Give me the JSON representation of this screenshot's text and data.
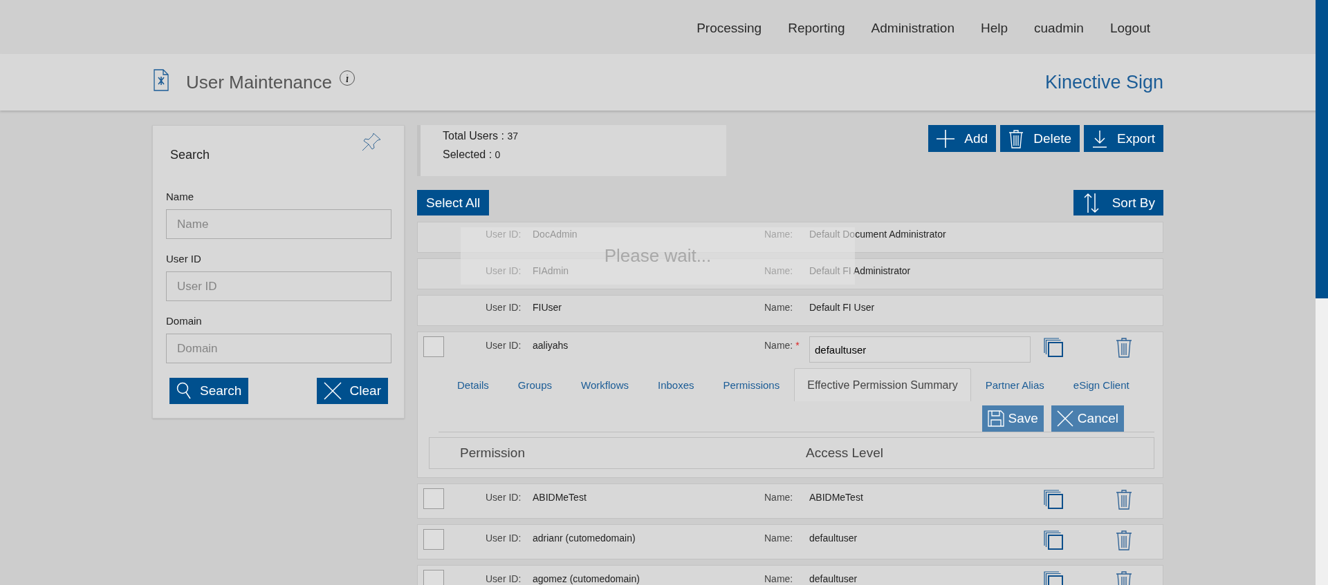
{
  "nav": [
    {
      "label": "Processing"
    },
    {
      "label": "Reporting"
    },
    {
      "label": "Administration"
    },
    {
      "label": "Help"
    },
    {
      "label": "cuadmin"
    },
    {
      "label": "Logout"
    }
  ],
  "page_header": {
    "title": "User Maintenance",
    "brand": "Kinective Sign"
  },
  "search_panel": {
    "title": "Search",
    "fields": [
      {
        "label": "Name",
        "placeholder": "Name"
      },
      {
        "label": "User ID",
        "placeholder": "User ID"
      },
      {
        "label": "Domain",
        "placeholder": "Domain"
      }
    ],
    "buttons": [
      {
        "kind": "search",
        "label": "Search"
      },
      {
        "kind": "clear",
        "label": "Clear"
      }
    ]
  },
  "summary": {
    "total_label": "Total Users :",
    "total": "37",
    "selected_label": "Selected :",
    "selected": "0"
  },
  "toolbar": [
    {
      "kind": "add",
      "label": "Add"
    },
    {
      "kind": "delete",
      "label": "Delete"
    },
    {
      "kind": "export",
      "label": "Export"
    }
  ],
  "select_all": "Select All",
  "sort_by": "Sort By",
  "users": [
    {
      "kind": "system",
      "user_id_label": "User ID:",
      "user_id": "DocAdmin",
      "name_label": "Name:",
      "name": "Default Document Administrator"
    },
    {
      "kind": "system",
      "user_id_label": "User ID:",
      "user_id": "FIAdmin",
      "name_label": "Name:",
      "name": "Default FI Administrator"
    },
    {
      "kind": "system",
      "user_id_label": "User ID:",
      "user_id": "FIUser",
      "name_label": "Name:",
      "name": "Default FI User"
    },
    {
      "kind": "user",
      "checked": false,
      "expanded": true,
      "user_id_label": "User ID:",
      "user_id": "aaliyahs",
      "name_label": "Name:",
      "required_mark": "*",
      "name": "defaultuser",
      "tabs": [
        {
          "label": "Details",
          "selected": false
        },
        {
          "label": "Groups",
          "selected": false
        },
        {
          "label": "Workflows",
          "selected": false
        },
        {
          "label": "Inboxes",
          "selected": false
        },
        {
          "label": "Permissions",
          "selected": false
        },
        {
          "label": "Effective Permission Summary",
          "selected": true
        },
        {
          "label": "Partner Alias",
          "selected": false
        },
        {
          "label": "eSign Client",
          "selected": false
        }
      ],
      "actions": [
        {
          "kind": "save",
          "label": "Save",
          "disabled": true
        },
        {
          "kind": "cancel",
          "label": "Cancel",
          "disabled": true
        }
      ],
      "columns": [
        "Permission",
        "Access Level"
      ]
    },
    {
      "kind": "user",
      "checked": false,
      "expanded": false,
      "user_id_label": "User ID:",
      "user_id": "ABIDMeTest",
      "name_label": "Name:",
      "name": "ABIDMeTest"
    },
    {
      "kind": "user",
      "checked": false,
      "expanded": false,
      "user_id_label": "User ID:",
      "user_id": "adrianr (cutomedomain)",
      "name_label": "Name:",
      "name": "defaultuser"
    },
    {
      "kind": "user",
      "checked": false,
      "expanded": false,
      "user_id_label": "User ID:",
      "user_id": "agomez (cutomedomain)",
      "name_label": "Name:",
      "name": "defaultuser"
    }
  ],
  "loading": {
    "message": "Please wait..."
  }
}
